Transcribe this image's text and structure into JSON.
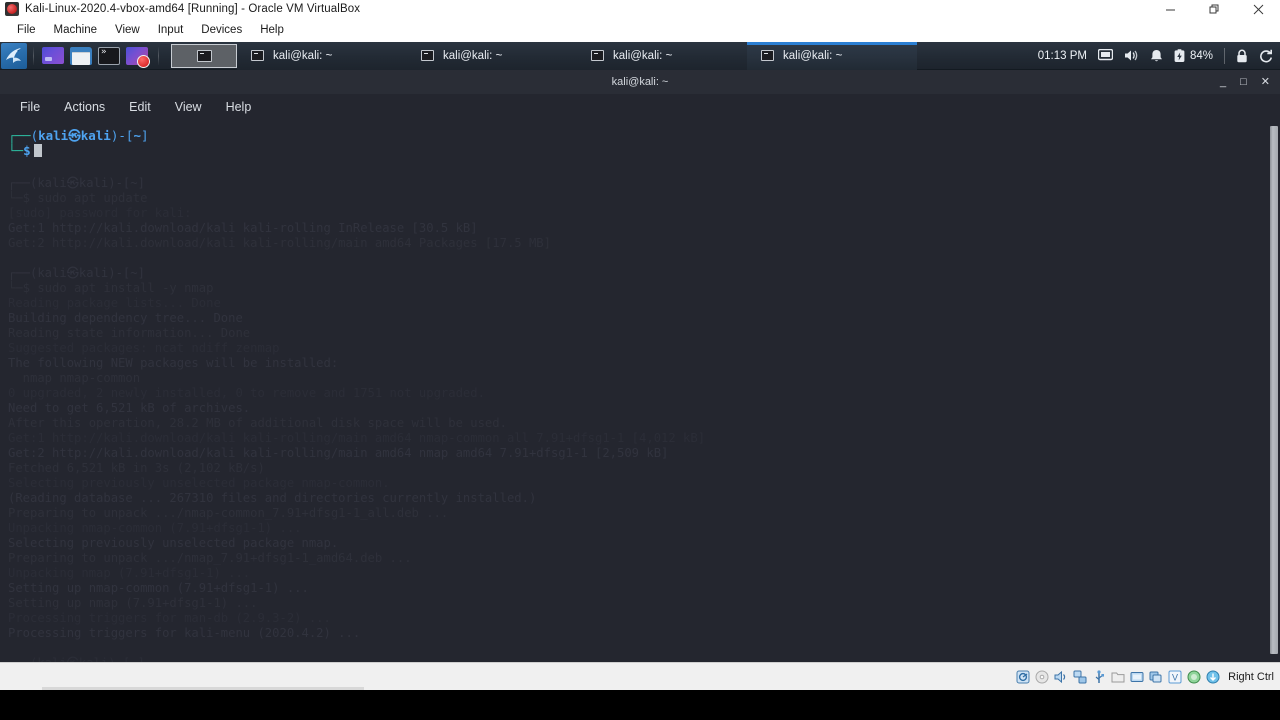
{
  "host": {
    "window_title": "Kali-Linux-2020.4-vbox-amd64 [Running] - Oracle VM VirtualBox",
    "app_icon": "virtualbox-icon",
    "window_controls": [
      {
        "name": "minimize",
        "glyph": "minimize-icon"
      },
      {
        "name": "restore",
        "glyph": "restore-icon"
      },
      {
        "name": "close",
        "glyph": "close-icon"
      }
    ],
    "menu": [
      {
        "label": "File"
      },
      {
        "label": "Machine"
      },
      {
        "label": "View"
      },
      {
        "label": "Input"
      },
      {
        "label": "Devices"
      },
      {
        "label": "Help"
      }
    ],
    "statusbar": {
      "host_key": "Right Ctrl",
      "icons": [
        "hard-disk-icon",
        "optical-disk-icon",
        "audio-icon",
        "network-icon",
        "usb-icon",
        "shared-folders-icon",
        "display-icon",
        "recording-icon",
        "virtualization-icon",
        "mouse-integration-icon",
        "keyboard-capture-icon"
      ]
    }
  },
  "guest": {
    "panel": {
      "menu_icon": "kali-dragon-icon",
      "launchers": [
        {
          "name": "workspace-switcher",
          "icon": "workspace-switcher-icon"
        },
        {
          "name": "file-manager",
          "icon": "file-manager-icon"
        },
        {
          "name": "terminal-emulator",
          "icon": "terminal-icon"
        },
        {
          "name": "web-browser",
          "icon": "web-browser-icon"
        }
      ],
      "blank_window_button": {
        "name": "window-button-blank",
        "icon": "terminal-icon",
        "label": ""
      },
      "tasks": [
        {
          "label": "kali@kali: ~",
          "icon": "terminal-icon",
          "active": false
        },
        {
          "label": "kali@kali: ~",
          "icon": "terminal-icon",
          "active": false
        },
        {
          "label": "kali@kali: ~",
          "icon": "terminal-icon",
          "active": false
        },
        {
          "label": "kali@kali: ~",
          "icon": "terminal-icon",
          "active": true
        }
      ],
      "tray": {
        "clock": "01:13 PM",
        "display_icon": "display-icon",
        "volume_icon": "speaker-icon",
        "notification_icon": "bell-icon",
        "battery_icon": "battery-icon",
        "battery_percent": "84%",
        "lock_icon": "lock-icon",
        "logout_icon": "power-logout-icon"
      }
    },
    "terminal": {
      "title": "kali@kali: ~",
      "window_controls": [
        {
          "name": "minimize",
          "glyph": "_"
        },
        {
          "name": "maximize",
          "glyph": "□"
        },
        {
          "name": "close",
          "glyph": "✕"
        }
      ],
      "menu": [
        {
          "label": "File"
        },
        {
          "label": "Actions"
        },
        {
          "label": "Edit"
        },
        {
          "label": "View"
        },
        {
          "label": "Help"
        }
      ],
      "prompt": {
        "corner_top": "┌──",
        "corner_bottom": "└─",
        "open_paren": "(",
        "user": "kali",
        "at": "㉿",
        "host": "kali",
        "close_paren": ")",
        "dash": "-",
        "bracket_open": "[",
        "path": "~",
        "bracket_close": "]",
        "dollar": "$",
        "input": ""
      },
      "scrollback_ghost": [
        "┌──(kali㉿kali)-[~]",
        "└─$ sudo apt update",
        "[sudo] password for kali:",
        "Get:1 http://kali.download/kali kali-rolling InRelease [30.5 kB]",
        "Get:2 http://kali.download/kali kali-rolling/main amd64 Packages [17.5 MB]",
        "",
        "┌──(kali㉿kali)-[~]",
        "└─$ sudo apt install -y nmap",
        "Reading package lists... Done",
        "Building dependency tree... Done",
        "Reading state information... Done",
        "Suggested packages: ncat ndiff zenmap",
        "The following NEW packages will be installed:",
        "  nmap nmap-common",
        "0 upgraded, 2 newly installed, 0 to remove and 1751 not upgraded.",
        "Need to get 6,521 kB of archives.",
        "After this operation, 28.2 MB of additional disk space will be used.",
        "Get:1 http://kali.download/kali kali-rolling/main amd64 nmap-common all 7.91+dfsg1-1 [4,012 kB]",
        "Get:2 http://kali.download/kali kali-rolling/main amd64 nmap amd64 7.91+dfsg1-1 [2,509 kB]",
        "Fetched 6,521 kB in 3s (2,102 kB/s)",
        "Selecting previously unselected package nmap-common.",
        "(Reading database ... 267310 files and directories currently installed.)",
        "Preparing to unpack .../nmap-common_7.91+dfsg1-1_all.deb ...",
        "Unpacking nmap-common (7.91+dfsg1-1) ...",
        "Selecting previously unselected package nmap.",
        "Preparing to unpack .../nmap_7.91+dfsg1-1_amd64.deb ...",
        "Unpacking nmap (7.91+dfsg1-1) ...",
        "Setting up nmap-common (7.91+dfsg1-1) ...",
        "Setting up nmap (7.91+dfsg1-1) ...",
        "Processing triggers for man-db (2.9.3-2) ...",
        "Processing triggers for kali-menu (2020.4.2) ...",
        "",
        "┌──(kali㉿kali)-[~]",
        "└─$"
      ],
      "scrollbar": {
        "name": "terminal-scrollbar"
      }
    }
  },
  "colors": {
    "panel_bg": "#222a34",
    "panel_active": "#2b7fd4",
    "terminal_bg": "#24262f",
    "prompt_blue": "#4ea3f0",
    "prompt_green": "#2dbaa0",
    "host_chrome": "#ffffff",
    "statusbar_bg": "#f0f0f0"
  }
}
